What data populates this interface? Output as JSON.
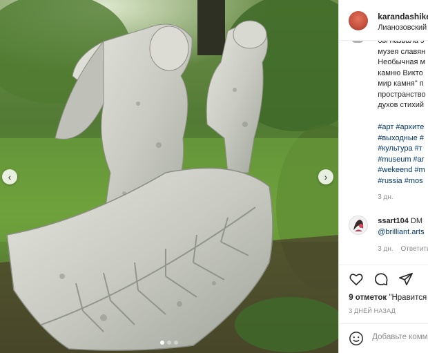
{
  "header": {
    "username": "karandashike",
    "location": "Лианозовский п"
  },
  "caption": {
    "lines": [
      "бы назвала э",
      "музея славян",
      "Необычная м",
      "камню Викто",
      "мир камня\" п",
      "пространство",
      "духов стихий"
    ],
    "hashtags": [
      "#арт #архите",
      "#выходные #",
      "#культура #т",
      "#museum #ar",
      "#wekeend #m",
      "#russia #mos"
    ],
    "time": "3 дн."
  },
  "comment": {
    "user": "ssart104",
    "text": "DM",
    "mention": "@brilliant.arts",
    "time": "3 дн.",
    "reply_label": "Ответить"
  },
  "likes": {
    "count": "9 отметок",
    "text": "\"Нравится"
  },
  "post_date": "3 ДНЕЙ НАЗАД",
  "add_comment": {
    "placeholder": "Добавьте комм"
  },
  "icons": {
    "like": "heart-icon",
    "comment": "comment-icon",
    "share": "share-icon",
    "emoji": "emoji-icon",
    "prev": "chevron-left-icon",
    "next": "chevron-right-icon"
  },
  "carousel": {
    "slide_count": 3,
    "active_index": 0
  },
  "colors": {
    "link": "#00376b",
    "text": "#262626",
    "muted": "#8e8e8e"
  }
}
